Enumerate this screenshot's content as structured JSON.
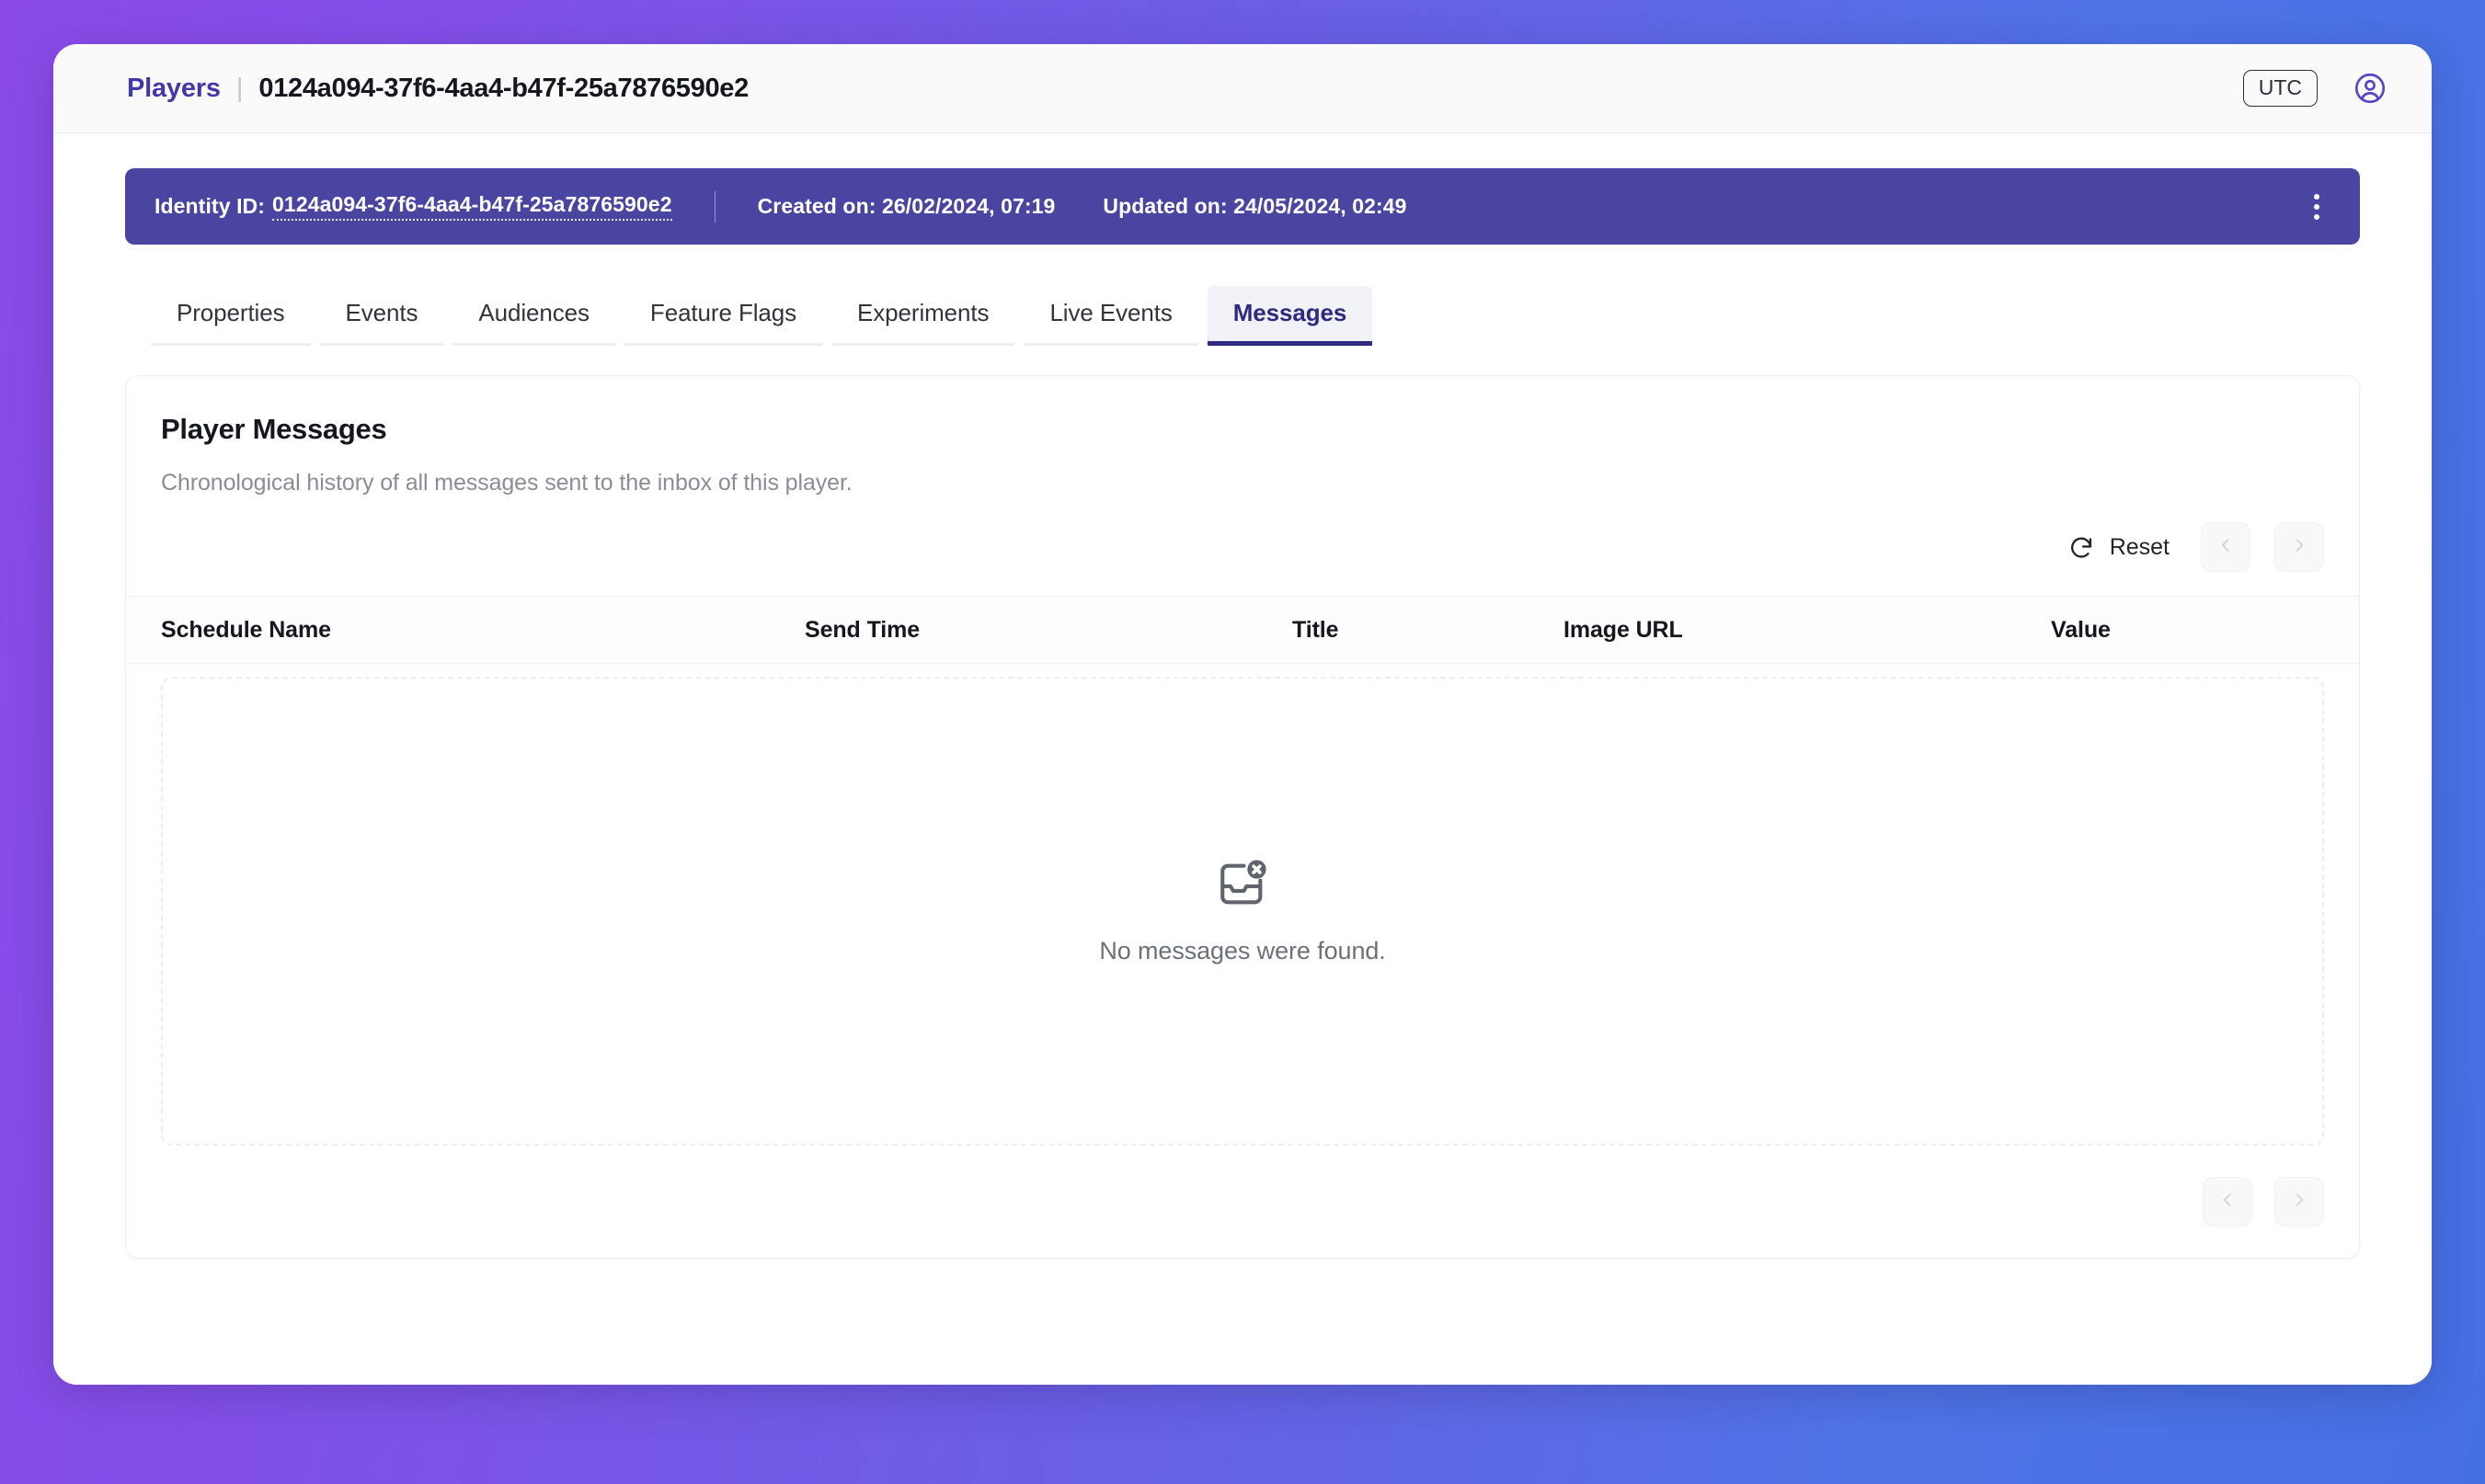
{
  "header": {
    "breadcrumb_section": "Players",
    "breadcrumb_divider": "|",
    "breadcrumb_id": "0124a094-37f6-4aa4-b47f-25a7876590e2",
    "timezone_badge": "UTC",
    "profile_icon": "user-circle-icon"
  },
  "identity_banner": {
    "label": "Identity ID:",
    "value": "0124a094-37f6-4aa4-b47f-25a7876590e2",
    "created": "Created on: 26/02/2024, 07:19",
    "updated": "Updated on: 24/05/2024, 02:49",
    "menu_icon": "kebab-menu-icon",
    "background_color": "#4a45a0"
  },
  "tabs": [
    {
      "label": "Properties",
      "active": false
    },
    {
      "label": "Events",
      "active": false
    },
    {
      "label": "Audiences",
      "active": false
    },
    {
      "label": "Feature Flags",
      "active": false
    },
    {
      "label": "Experiments",
      "active": false
    },
    {
      "label": "Live Events",
      "active": false
    },
    {
      "label": "Messages",
      "active": true
    }
  ],
  "card": {
    "title": "Player Messages",
    "subtitle": "Chronological history of all messages sent to the inbox of this player.",
    "reset_label": "Reset",
    "reset_icon": "refresh-icon",
    "prev_icon": "chevron-left-icon",
    "next_icon": "chevron-right-icon"
  },
  "table": {
    "columns": [
      "Schedule Name",
      "Send Time",
      "Title",
      "Image URL",
      "Value"
    ],
    "rows": [],
    "empty_icon": "inbox-x-icon",
    "empty_message": "No messages were found."
  },
  "colors": {
    "accent_purple": "#4338a8",
    "banner": "#4a45a0",
    "active_tab_text": "#2e2a80",
    "bg_gradient_start": "#8b4ae8",
    "bg_gradient_end": "#4570e4"
  }
}
